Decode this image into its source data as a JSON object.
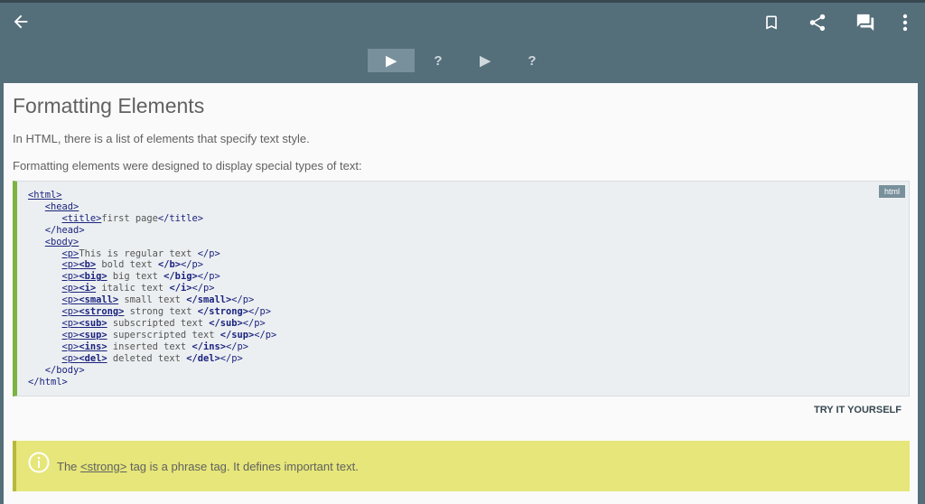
{
  "toolbar": {
    "back_icon": "arrow-left-icon",
    "actions": [
      "bookmark-icon",
      "share-icon",
      "comments-icon",
      "more-vert-icon"
    ]
  },
  "tabs": [
    {
      "label": "▶",
      "active": true
    },
    {
      "label": "?",
      "active": false
    },
    {
      "label": "▶",
      "active": false
    },
    {
      "label": "?",
      "active": false
    }
  ],
  "lesson": {
    "title": "Formatting Elements",
    "para1": "In HTML, there is a list of elements that specify text style.",
    "para2": "Formatting elements were designed to display special types of text:"
  },
  "code": {
    "language": "html",
    "lines": [
      {
        "text": "<html>"
      },
      {
        "text": "   <head>"
      },
      {
        "text": "      <title>first page</title>"
      },
      {
        "text": "   </head>"
      },
      {
        "text": "   <body>"
      },
      {
        "text": "      <p>This is regular text </p>"
      },
      {
        "text": "      <p><b> bold text </b></p>"
      },
      {
        "text": "      <p><big> big text </big></p>"
      },
      {
        "text": "      <p><i> italic text </i></p>"
      },
      {
        "text": "      <p><small> small text </small></p>"
      },
      {
        "text": "      <p><strong> strong text </strong></p>"
      },
      {
        "text": "      <p><sub> subscripted text </sub></p>"
      },
      {
        "text": "      <p><sup> superscripted text </sup></p>"
      },
      {
        "text": "      <p><ins> inserted text </ins></p>"
      },
      {
        "text": "      <p><del> deleted text </del></p>"
      },
      {
        "text": "   </body>"
      },
      {
        "text": "</html>"
      }
    ]
  },
  "try_label": "TRY IT YOURSELF",
  "note": {
    "icon": "info-icon",
    "before": "The ",
    "tag": "<strong>",
    "after": " tag is a phrase tag. It defines important text."
  },
  "colors": {
    "toolbar": "#546e7a",
    "accent": "#7cb342",
    "note_bg": "#e6e67a",
    "code_tag": "#1a237e"
  }
}
